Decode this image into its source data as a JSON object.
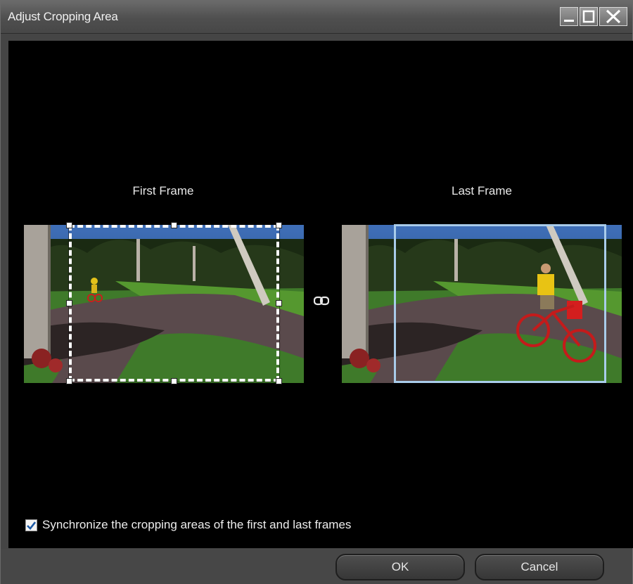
{
  "window": {
    "title": "Adjust Cropping Area",
    "controls": [
      "minimize-icon",
      "maximize-icon",
      "close-icon"
    ]
  },
  "frames": {
    "first_label": "First Frame",
    "last_label": "Last Frame",
    "link_icon": "chain-link-icon"
  },
  "sync": {
    "checked": true,
    "label": "Synchronize the cropping areas of the first and last frames"
  },
  "buttons": {
    "ok": "OK",
    "cancel": "Cancel"
  },
  "colors": {
    "crop_selected_border": "#a9ccea",
    "background": "#000000",
    "chrome": "#454545"
  }
}
